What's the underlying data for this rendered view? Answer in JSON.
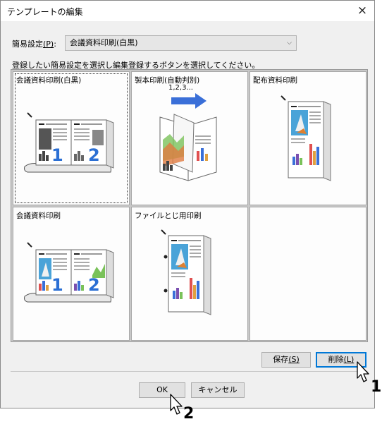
{
  "dialog": {
    "title": "テンプレートの編集",
    "close_glyph": "×"
  },
  "simple_setting": {
    "label": "簡易設定",
    "accelerator": "(P)",
    "label_suffix": ":",
    "value": "会議資料印刷(白黒)",
    "arrow": "⌵"
  },
  "instruction": "登録したい簡易設定を選択し編集登録するボタンを選択してください。",
  "templates": [
    {
      "label": "会議資料印刷(白黒)",
      "sub": "",
      "selected": true
    },
    {
      "label": "製本印刷(自動判別)",
      "sub": "1,2,3...",
      "selected": false
    },
    {
      "label": "配布資料印刷",
      "sub": "",
      "selected": false
    },
    {
      "label": "会議資料印刷",
      "sub": "",
      "selected": false
    },
    {
      "label": "ファイルとじ用印刷",
      "sub": "",
      "selected": false
    },
    {
      "label": "",
      "sub": "",
      "selected": false
    }
  ],
  "buttons": {
    "save": {
      "label": "保存",
      "accelerator": "(S)"
    },
    "delete": {
      "label": "削除",
      "accelerator": "(L)"
    },
    "ok": {
      "label": "OK"
    },
    "cancel": {
      "label": "キャンセル"
    }
  },
  "step_markers": [
    "1",
    "2"
  ],
  "colors": {
    "accent": "#0078d7",
    "arrow_blue": "#3a6fd8",
    "page_number_blue": "#2b6fd4"
  }
}
